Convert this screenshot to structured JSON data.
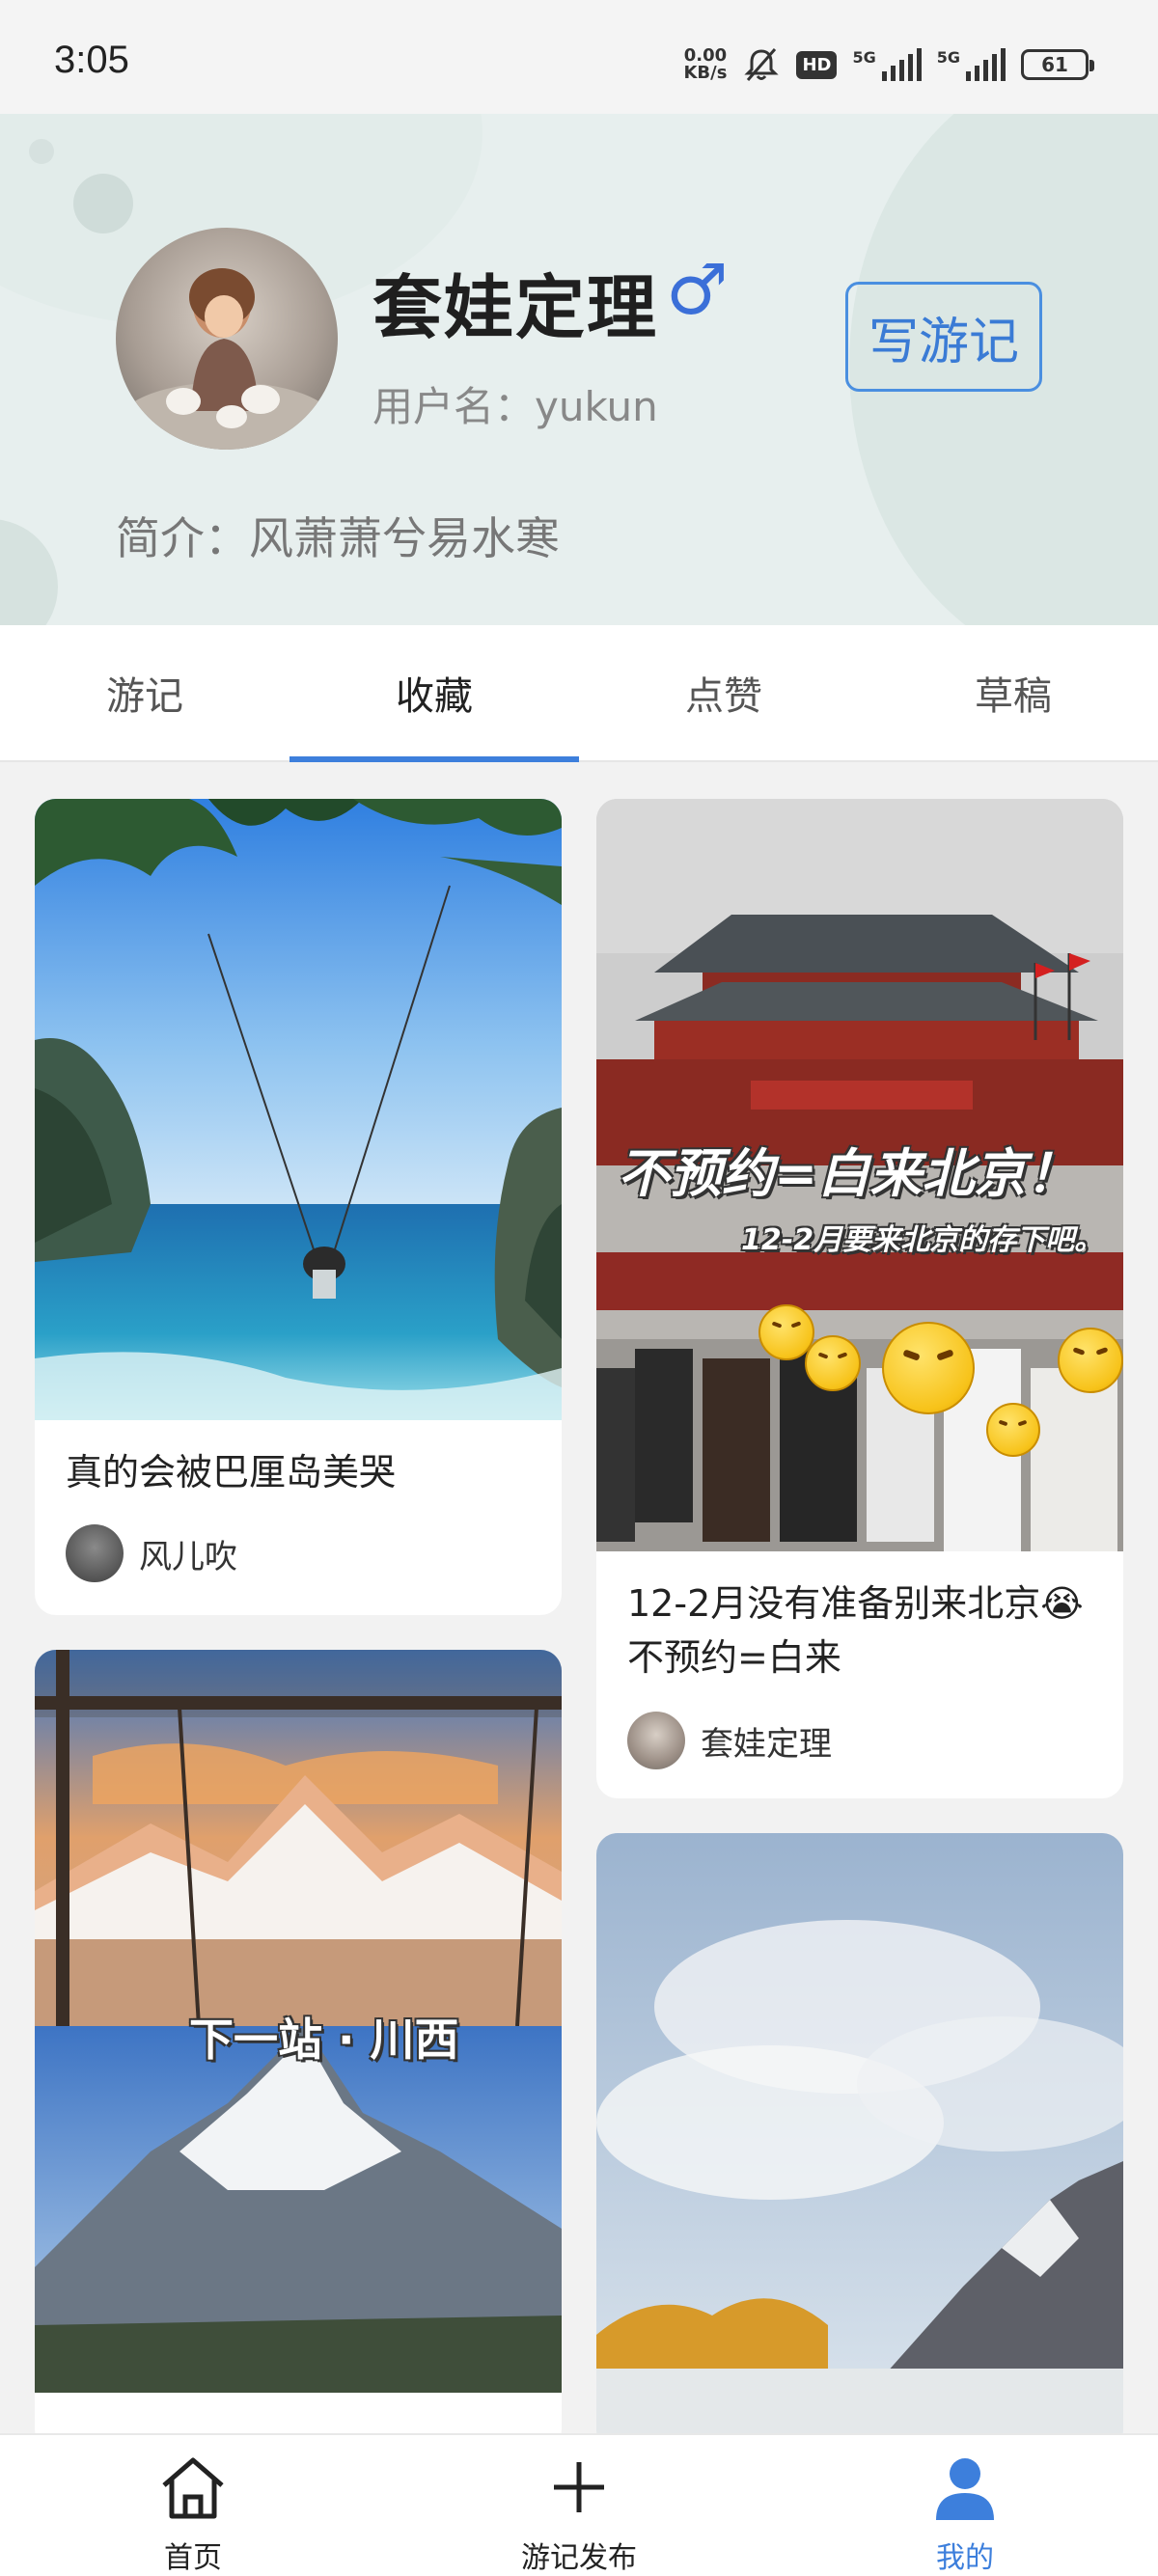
{
  "status_bar": {
    "time": "3:05",
    "net_speed_value": "0.00",
    "net_speed_unit": "KB/s",
    "hd_badge": "HD",
    "signal1_label": "5G",
    "signal2_label": "5G",
    "battery": "61"
  },
  "profile": {
    "nickname": "套娃定理",
    "gender_symbol": "♂",
    "username": "用户名：yukun",
    "write_button": "写游记",
    "bio": "简介：风萧萧兮易水寒",
    "accent_color": "#3d7fdc"
  },
  "tabs": [
    {
      "label": "游记",
      "active": false
    },
    {
      "label": "收藏",
      "active": true
    },
    {
      "label": "点赞",
      "active": false
    },
    {
      "label": "草稿",
      "active": false
    }
  ],
  "cards": [
    {
      "title": "真的会被巴厘岛美哭",
      "author": "风儿吹"
    },
    {
      "title": "12-2月没有准备别来北京😭不预约=白来",
      "author": "套娃定理",
      "overlay_main": "不预约=白来北京！",
      "overlay_sub": "12-2月要来北京的存下吧。"
    },
    {
      "title": "",
      "author": "",
      "overlay_main": "下一站 · 川西"
    },
    {
      "title": "",
      "author": ""
    }
  ],
  "bottom_nav": [
    {
      "label": "首页",
      "icon": "home-icon",
      "active": false
    },
    {
      "label": "游记发布",
      "icon": "plus-icon",
      "active": false
    },
    {
      "label": "我的",
      "icon": "user-icon",
      "active": true
    }
  ]
}
